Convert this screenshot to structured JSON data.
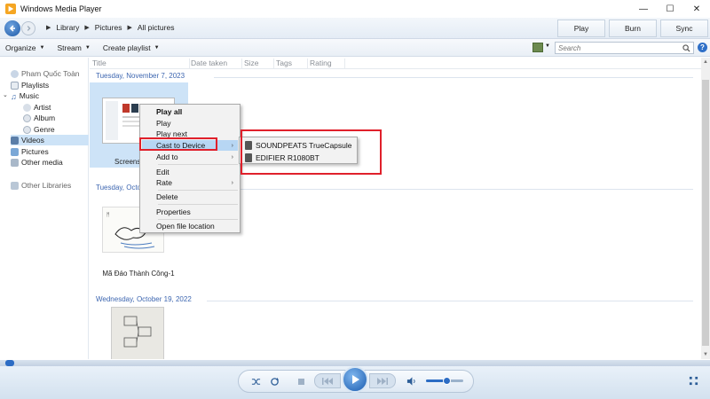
{
  "window": {
    "title": "Windows Media Player",
    "minimize": "—",
    "maximize": "☐",
    "close": "✕"
  },
  "nav": {
    "breadcrumb": [
      "Library",
      "Pictures",
      "All pictures"
    ],
    "tabs": [
      "Play",
      "Burn",
      "Sync"
    ]
  },
  "toolbar": {
    "organize": "Organize",
    "stream": "Stream",
    "create_playlist": "Create playlist",
    "search_placeholder": "Search"
  },
  "sidebar": {
    "user": "Pham Quốc Toàn",
    "playlists": "Playlists",
    "music": "Music",
    "artist": "Artist",
    "album": "Album",
    "genre": "Genre",
    "videos": "Videos",
    "pictures": "Pictures",
    "other_media": "Other media",
    "other_libraries": "Other Libraries"
  },
  "columns": [
    "Title",
    "Date taken",
    "Size",
    "Tags",
    "Rating"
  ],
  "groups": [
    {
      "label": "Tuesday, November 7, 2023",
      "item_caption": "Screens"
    },
    {
      "label": "Tuesday, Octo",
      "item_caption": "Mã Đáo Thành Công-1"
    },
    {
      "label": "Wednesday, October 19, 2022",
      "item_caption": ""
    }
  ],
  "context_menu": {
    "items": [
      "Play all",
      "Play",
      "Play next",
      "Cast to Device",
      "Add to",
      "Edit",
      "Rate",
      "Delete",
      "Properties",
      "Open file location"
    ],
    "highlighted": "Cast to Device"
  },
  "cast_submenu": {
    "devices": [
      "SOUNDPEATS TrueCapsule",
      "EDIFIER R1080BT"
    ]
  },
  "playback": {
    "volume": 0.55,
    "seek_position": 0.0
  },
  "colors": {
    "annotation_red": "#e0202b",
    "accent_blue": "#2c6cc4",
    "selection": "#cde3f7"
  },
  "icons": [
    "app-icon",
    "back-icon",
    "forward-icon",
    "search-icon",
    "help-icon",
    "shuffle-icon",
    "repeat-icon",
    "stop-icon",
    "previous-icon",
    "play-icon",
    "next-icon",
    "volume-icon",
    "switch-view-icon"
  ]
}
